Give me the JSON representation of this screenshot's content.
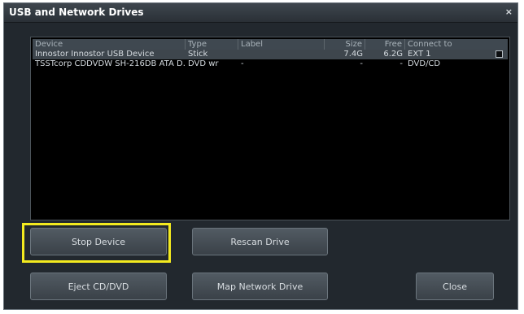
{
  "window": {
    "title": "USB and Network Drives",
    "close_glyph": "×"
  },
  "table": {
    "columns": [
      "Device",
      "Type",
      "Label",
      "Size",
      "Free",
      "Connect to"
    ],
    "rows": [
      {
        "device": "Innostor Innostor USB Device",
        "type": "Stick",
        "label": "",
        "size": "7.4G",
        "free": "6.2G",
        "connect_to": "EXT 1",
        "selected": true,
        "checkbox": true
      },
      {
        "device": "TSSTcorp CDDVDW SH-216DB ATA D...",
        "type": "DVD wr",
        "label": "-",
        "size": "-",
        "free": "-",
        "connect_to": "DVD/CD",
        "selected": false,
        "checkbox": false
      }
    ]
  },
  "buttons": {
    "stop_device": "Stop Device",
    "rescan_drive": "Rescan Drive",
    "eject_cd_dvd": "Eject CD/DVD",
    "map_network_drive": "Map Network Drive",
    "close": "Close"
  },
  "colors": {
    "highlight": "#f3ea1f",
    "background": "#22282e",
    "table_bg": "#000000"
  }
}
